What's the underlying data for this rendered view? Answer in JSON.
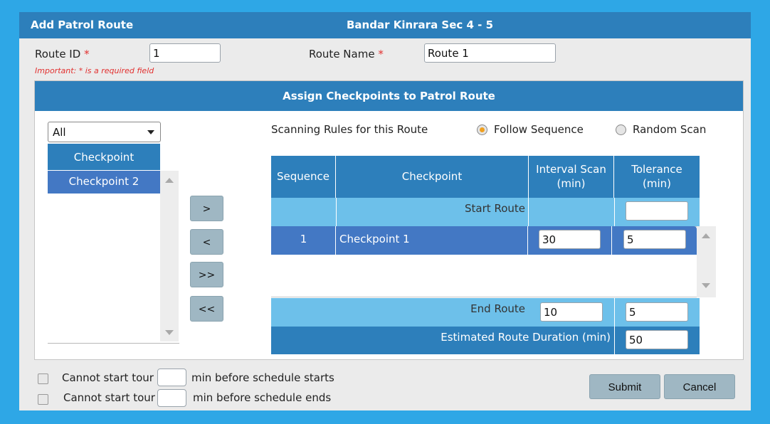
{
  "window": {
    "title": "Add Patrol Route",
    "location": "Bandar Kinrara Sec 4 - 5"
  },
  "form": {
    "route_id_label": "Route ID",
    "route_id_value": "1",
    "route_name_label": "Route Name",
    "route_name_value": "Route 1",
    "required_mark": "*",
    "important_note": "Important: * is a required field"
  },
  "assign": {
    "heading": "Assign Checkpoints to Patrol Route",
    "filter_selected": "All",
    "list_header": "Checkpoint",
    "available_items": [
      "Checkpoint 2"
    ],
    "move_buttons": [
      ">",
      "<",
      ">>",
      "<<"
    ]
  },
  "rules": {
    "label": "Scanning Rules for this Route",
    "options": [
      {
        "label": "Follow Sequence",
        "selected": true
      },
      {
        "label": "Random Scan",
        "selected": false
      }
    ]
  },
  "table": {
    "headers": [
      "Sequence",
      "Checkpoint",
      "Interval Scan (min)",
      "Tolerance (min)"
    ],
    "header_lines": {
      "interval": [
        "Interval Scan",
        "(min)"
      ],
      "tolerance": [
        "Tolerance",
        "(min)"
      ]
    },
    "start_route_label": "Start Route",
    "start_route_tolerance": "",
    "rows": [
      {
        "sequence": "1",
        "checkpoint": "Checkpoint 1",
        "interval": "30",
        "tolerance": "5"
      }
    ],
    "end_route_label": "End Route",
    "end_route_interval": "10",
    "end_route_tolerance": "5",
    "estimated_label": "Estimated Route Duration (min)",
    "estimated_value": "50"
  },
  "constraints": [
    {
      "prefix": "Cannot start tour",
      "suffix": "min before schedule starts",
      "value": "",
      "checked": false
    },
    {
      "prefix": "Cannot start tour",
      "suffix": "min before schedule ends",
      "value": "",
      "checked": false
    }
  ],
  "actions": {
    "submit": "Submit",
    "cancel": "Cancel"
  },
  "colors": {
    "frame": "#2ea7e6",
    "header_blue": "#2d7fbb",
    "row_blue": "#4378c4",
    "light_blue": "#6dc0ea",
    "button": "#9fb7c3",
    "required": "#e2302f",
    "radio_selected": "#f0a020"
  }
}
